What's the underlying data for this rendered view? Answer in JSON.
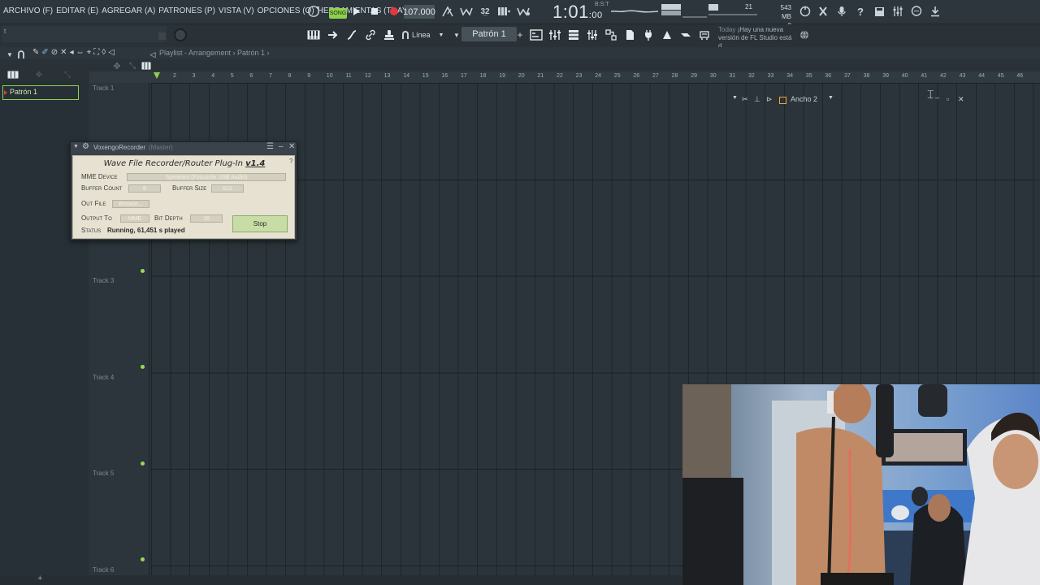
{
  "menu": [
    "ARCHIVO (F)",
    "EDITAR (E)",
    "AGREGAR (A)",
    "PATRONES (P)",
    "VISTA (V)",
    "OPCIONES (O)",
    "HERRAMIENTAS (T)",
    "AYUDA"
  ],
  "transport": {
    "song_label": "SONG",
    "tempo": "107.000",
    "time": "1:01",
    "time_frac": ":00",
    "beat_label": "B:S:T"
  },
  "performance": {
    "cpu": "21",
    "memory": "543 MB",
    "memory2": "0"
  },
  "hint_text": "t",
  "snap": {
    "value": "Línea"
  },
  "pattern_selector": {
    "value": "Patrón 1"
  },
  "news": {
    "date": "Today",
    "text": "¡Hay una nueva versión de FL Studio está d..."
  },
  "playlist": {
    "title": "Playlist - Arrangement › Patrón 1 ›",
    "patterns": [
      "Patrón 1"
    ],
    "bar_numbers": [
      "2",
      "3",
      "4",
      "5",
      "6",
      "7",
      "8",
      "9",
      "10",
      "11",
      "12",
      "13",
      "14",
      "15",
      "16",
      "17",
      "18",
      "19",
      "20",
      "21",
      "22",
      "23",
      "24",
      "25",
      "26",
      "27",
      "28",
      "29",
      "30",
      "31",
      "32",
      "33",
      "34",
      "35",
      "36",
      "37",
      "38",
      "39",
      "40",
      "41",
      "42",
      "43",
      "44",
      "45",
      "46"
    ],
    "tracks": [
      "Track 1",
      "Track 3",
      "Track 4",
      "Track 5",
      "Track 6"
    ]
  },
  "floating_window": {
    "title": "Ancho 2"
  },
  "voxengo": {
    "window_title": "VoxengoRecorder",
    "window_subtitle": "(Master)",
    "heading": "Wave File Recorder/Router Plug-In",
    "version": "v1.4",
    "help": "?",
    "mme_device_label": "MME Device",
    "mme_device_value": "Speakers (Focusrite USB Audio)",
    "buffer_count_label": "Buffer Count",
    "buffer_count_value": "8",
    "buffer_size_label": "Buffer Size",
    "buffer_size_value": "512",
    "out_file_label": "Out File",
    "browse_label": "Browse...",
    "output_to_label": "Output To",
    "output_to_value": "MME",
    "bit_depth_label": "Bit Depth",
    "bit_depth_value": "16",
    "stop_label": "Stop",
    "status_label": "Status",
    "status_value": "Running, 61,451 s played"
  },
  "colors": {
    "accent_green": "#8fd14f",
    "background": "#2a3238",
    "plugin_panel": "#e6e1d1"
  }
}
